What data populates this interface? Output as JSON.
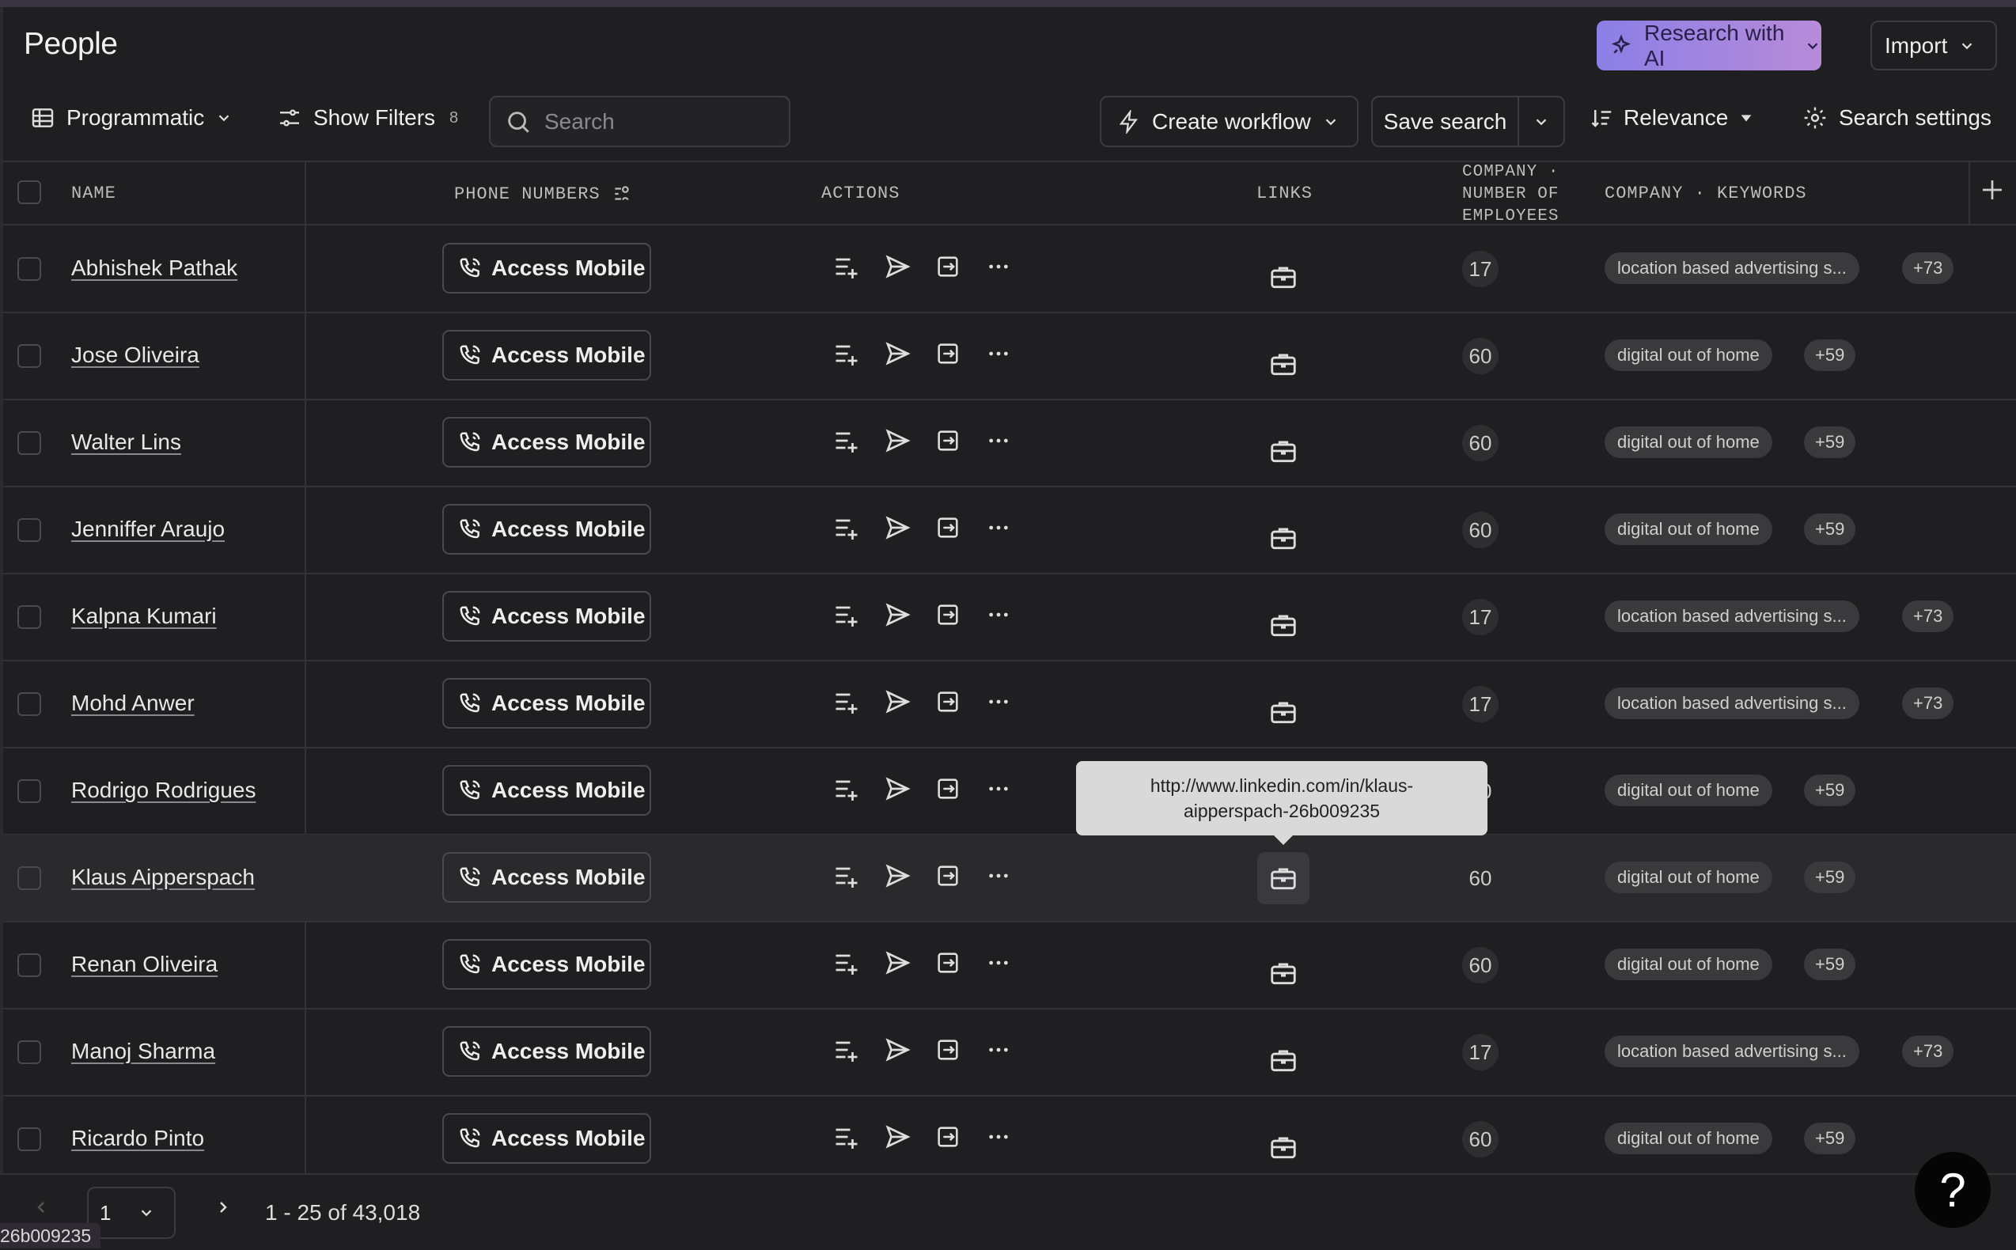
{
  "header": {
    "title": "People",
    "research_label": "Research with AI",
    "import_label": "Import"
  },
  "toolbar": {
    "view_label": "Programmatic",
    "filters_label": "Show Filters",
    "filters_count": "8",
    "search_placeholder": "Search",
    "workflow_label": "Create workflow",
    "save_label": "Save search",
    "sort_label": "Relevance",
    "settings_label": "Search settings"
  },
  "columns": {
    "name": "NAME",
    "phone": "PHONE NUMBERS",
    "actions": "ACTIONS",
    "links": "LINKS",
    "employees_1": "COMPANY ·",
    "employees_2": "NUMBER OF",
    "employees_3": "EMPLOYEES",
    "keywords": "COMPANY · KEYWORDS"
  },
  "access_label": "Access Mobile",
  "rows": [
    {
      "name": "Abhishek Pathak",
      "employees": "17",
      "keyword": "location based advertising s...",
      "more": "+73"
    },
    {
      "name": "Jose Oliveira",
      "employees": "60",
      "keyword": "digital out of home",
      "more": "+59"
    },
    {
      "name": "Walter Lins",
      "employees": "60",
      "keyword": "digital out of home",
      "more": "+59"
    },
    {
      "name": "Jenniffer Araujo",
      "employees": "60",
      "keyword": "digital out of home",
      "more": "+59"
    },
    {
      "name": "Kalpna Kumari",
      "employees": "17",
      "keyword": "location based advertising s...",
      "more": "+73"
    },
    {
      "name": "Mohd Anwer",
      "employees": "17",
      "keyword": "location based advertising s...",
      "more": "+73"
    },
    {
      "name": "Rodrigo Rodrigues",
      "employees": "60",
      "keyword": "digital out of home",
      "more": "+59"
    },
    {
      "name": "Klaus Aipperspach",
      "employees": "60",
      "keyword": "digital out of home",
      "more": "+59"
    },
    {
      "name": "Renan Oliveira",
      "employees": "60",
      "keyword": "digital out of home",
      "more": "+59"
    },
    {
      "name": "Manoj Sharma",
      "employees": "17",
      "keyword": "location based advertising s...",
      "more": "+73"
    },
    {
      "name": "Ricardo Pinto",
      "employees": "60",
      "keyword": "digital out of home",
      "more": "+59"
    }
  ],
  "tooltip": {
    "line1": "http://www.linkedin.com/in/klaus-",
    "line2": "aipperspach-26b009235"
  },
  "pagination": {
    "page": "1",
    "range": "1 - 25 of 43,018"
  },
  "help_label": "?",
  "status_text": "26b009235",
  "icons": {
    "ai": "sparkle-icon",
    "view": "table-grid-icon",
    "filters": "filter-sliders-icon",
    "search": "search-icon",
    "workflow": "lightning-icon",
    "sort": "sort-list-icon",
    "settings": "gear-icon",
    "phone": "phone-call-icon",
    "actions": [
      "add-to-list-icon",
      "send-icon",
      "export-icon",
      "more-icon"
    ],
    "link": "briefcase-icon"
  },
  "colors": {
    "background": "#1f1f21",
    "ai_gradient_start": "#8b7fe6",
    "ai_gradient_end": "#b88bd9",
    "tooltip": "#d9d9d9"
  }
}
